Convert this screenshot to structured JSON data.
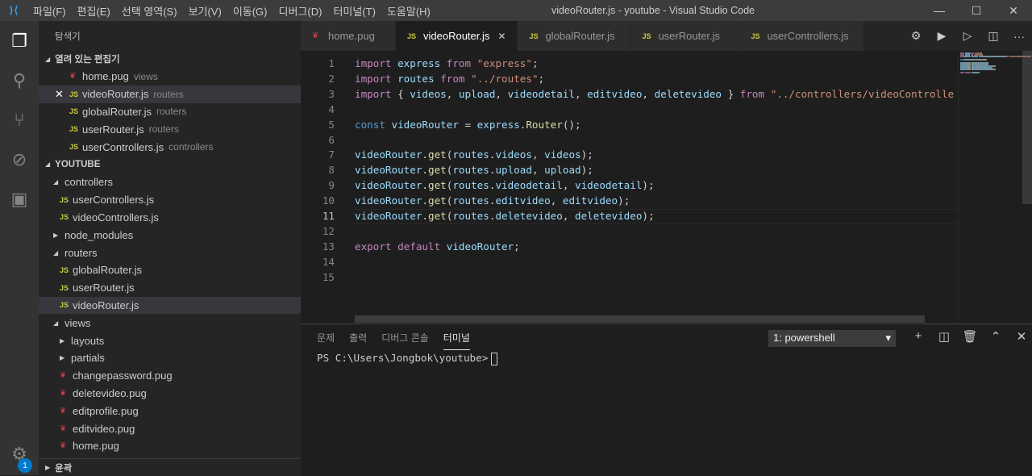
{
  "titlebar": {
    "title": "videoRouter.js - youtube - Visual Studio Code",
    "menus": [
      "파일(F)",
      "편집(E)",
      "선택 영역(S)",
      "보기(V)",
      "이동(G)",
      "디버그(D)",
      "터미널(T)",
      "도움말(H)"
    ]
  },
  "activity": {
    "items": [
      "files-icon",
      "search-icon",
      "source-control-icon",
      "debug-icon",
      "extensions-icon"
    ],
    "badge": "1"
  },
  "sidebar": {
    "title": "탐색기",
    "open_editors": {
      "label": "열려 있는 편집기",
      "items": [
        {
          "name": "home.pug",
          "desc": "views",
          "type": "pug"
        },
        {
          "name": "videoRouter.js",
          "desc": "routers",
          "type": "js"
        },
        {
          "name": "globalRouter.js",
          "desc": "routers",
          "type": "js"
        },
        {
          "name": "userRouter.js",
          "desc": "routers",
          "type": "js"
        },
        {
          "name": "userControllers.js",
          "desc": "controllers",
          "type": "js"
        }
      ]
    },
    "project": {
      "label": "YOUTUBE",
      "items": [
        {
          "name": "controllers",
          "kind": "folder-open",
          "depth": 0
        },
        {
          "name": "userControllers.js",
          "kind": "js",
          "depth": 1
        },
        {
          "name": "videoControllers.js",
          "kind": "js",
          "depth": 1
        },
        {
          "name": "node_modules",
          "kind": "folder",
          "depth": 0
        },
        {
          "name": "routers",
          "kind": "folder-open",
          "depth": 0
        },
        {
          "name": "globalRouter.js",
          "kind": "js",
          "depth": 1
        },
        {
          "name": "userRouter.js",
          "kind": "js",
          "depth": 1
        },
        {
          "name": "videoRouter.js",
          "kind": "js",
          "depth": 1,
          "selected": true
        },
        {
          "name": "views",
          "kind": "folder-open",
          "depth": 0
        },
        {
          "name": "layouts",
          "kind": "folder",
          "depth": 1
        },
        {
          "name": "partials",
          "kind": "folder",
          "depth": 1
        },
        {
          "name": "changepassword.pug",
          "kind": "pug",
          "depth": 1
        },
        {
          "name": "deletevideo.pug",
          "kind": "pug",
          "depth": 1
        },
        {
          "name": "editprofile.pug",
          "kind": "pug",
          "depth": 1
        },
        {
          "name": "editvideo.pug",
          "kind": "pug",
          "depth": 1
        },
        {
          "name": "home.pug",
          "kind": "pug",
          "depth": 1
        }
      ]
    },
    "outline": "윤곽"
  },
  "tabs": [
    {
      "name": "home.pug",
      "type": "pug"
    },
    {
      "name": "videoRouter.js",
      "type": "js",
      "active": true
    },
    {
      "name": "globalRouter.js",
      "type": "js"
    },
    {
      "name": "userRouter.js",
      "type": "js"
    },
    {
      "name": "userControllers.js",
      "type": "js"
    }
  ],
  "editor": {
    "current_line": 11,
    "lines": [
      [
        [
          "import",
          "kw"
        ],
        [
          " ",
          "pl"
        ],
        [
          "express",
          "id"
        ],
        [
          " ",
          "pl"
        ],
        [
          "from",
          "kw"
        ],
        [
          " ",
          "pl"
        ],
        [
          "\"express\"",
          "st"
        ],
        [
          ";",
          "pl"
        ]
      ],
      [
        [
          "import",
          "kw"
        ],
        [
          " ",
          "pl"
        ],
        [
          "routes",
          "id"
        ],
        [
          " ",
          "pl"
        ],
        [
          "from",
          "kw"
        ],
        [
          " ",
          "pl"
        ],
        [
          "\"../routes\"",
          "st"
        ],
        [
          ";",
          "pl"
        ]
      ],
      [
        [
          "import",
          "kw"
        ],
        [
          " { ",
          "pl"
        ],
        [
          "videos",
          "id"
        ],
        [
          ", ",
          "pl"
        ],
        [
          "upload",
          "id"
        ],
        [
          ", ",
          "pl"
        ],
        [
          "videodetail",
          "id"
        ],
        [
          ", ",
          "pl"
        ],
        [
          "editvideo",
          "id"
        ],
        [
          ", ",
          "pl"
        ],
        [
          "deletevideo",
          "id"
        ],
        [
          " } ",
          "pl"
        ],
        [
          "from",
          "kw"
        ],
        [
          " ",
          "pl"
        ],
        [
          "\"../controllers/videoControlle",
          "st"
        ]
      ],
      [],
      [
        [
          "const",
          "kb"
        ],
        [
          " ",
          "pl"
        ],
        [
          "videoRouter",
          "id"
        ],
        [
          " = ",
          "pl"
        ],
        [
          "express",
          "id"
        ],
        [
          ".",
          "pl"
        ],
        [
          "Router",
          "fn"
        ],
        [
          "();",
          "pl"
        ]
      ],
      [],
      [
        [
          "videoRouter",
          "id"
        ],
        [
          ".",
          "pl"
        ],
        [
          "get",
          "fn"
        ],
        [
          "(",
          "pl"
        ],
        [
          "routes",
          "id"
        ],
        [
          ".",
          "pl"
        ],
        [
          "videos",
          "id"
        ],
        [
          ", ",
          "pl"
        ],
        [
          "videos",
          "id"
        ],
        [
          ");",
          "pl"
        ]
      ],
      [
        [
          "videoRouter",
          "id"
        ],
        [
          ".",
          "pl"
        ],
        [
          "get",
          "fn"
        ],
        [
          "(",
          "pl"
        ],
        [
          "routes",
          "id"
        ],
        [
          ".",
          "pl"
        ],
        [
          "upload",
          "id"
        ],
        [
          ", ",
          "pl"
        ],
        [
          "upload",
          "id"
        ],
        [
          ");",
          "pl"
        ]
      ],
      [
        [
          "videoRouter",
          "id"
        ],
        [
          ".",
          "pl"
        ],
        [
          "get",
          "fn"
        ],
        [
          "(",
          "pl"
        ],
        [
          "routes",
          "id"
        ],
        [
          ".",
          "pl"
        ],
        [
          "videodetail",
          "id"
        ],
        [
          ", ",
          "pl"
        ],
        [
          "videodetail",
          "id"
        ],
        [
          ");",
          "pl"
        ]
      ],
      [
        [
          "videoRouter",
          "id"
        ],
        [
          ".",
          "pl"
        ],
        [
          "get",
          "fn"
        ],
        [
          "(",
          "pl"
        ],
        [
          "routes",
          "id"
        ],
        [
          ".",
          "pl"
        ],
        [
          "editvideo",
          "id"
        ],
        [
          ", ",
          "pl"
        ],
        [
          "editvideo",
          "id"
        ],
        [
          ");",
          "pl"
        ]
      ],
      [
        [
          "videoRouter",
          "id"
        ],
        [
          ".",
          "pl"
        ],
        [
          "get",
          "fn"
        ],
        [
          "(",
          "pl"
        ],
        [
          "routes",
          "id"
        ],
        [
          ".",
          "pl"
        ],
        [
          "deletevideo",
          "id"
        ],
        [
          ", ",
          "pl"
        ],
        [
          "deletevideo",
          "id"
        ],
        [
          ");",
          "pl"
        ]
      ],
      [],
      [
        [
          "export",
          "kw"
        ],
        [
          " ",
          "pl"
        ],
        [
          "default",
          "kw"
        ],
        [
          " ",
          "pl"
        ],
        [
          "videoRouter",
          "id"
        ],
        [
          ";",
          "pl"
        ]
      ],
      [],
      []
    ]
  },
  "panel": {
    "tabs": [
      "문제",
      "출력",
      "디버그 콘솔",
      "터미널"
    ],
    "active_tab": "터미널",
    "terminal_select": "1: powershell",
    "prompt": "PS C:\\Users\\Jongbok\\youtube>"
  }
}
